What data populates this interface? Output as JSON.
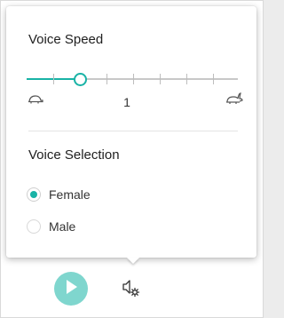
{
  "voice_speed": {
    "title": "Voice Speed",
    "value": "1",
    "slider_level": 0.25,
    "tick_count": 7,
    "slow_icon": "turtle-icon",
    "fast_icon": "rabbit-icon"
  },
  "voice_selection": {
    "title": "Voice Selection",
    "options": [
      {
        "label": "Female",
        "checked": true
      },
      {
        "label": "Male",
        "checked": false
      }
    ]
  },
  "toolbar": {
    "play_icon": "play-icon",
    "settings_icon": "voice-settings-icon"
  },
  "colors": {
    "accent": "#19b3a6",
    "play_button": "#7fd6ce"
  }
}
